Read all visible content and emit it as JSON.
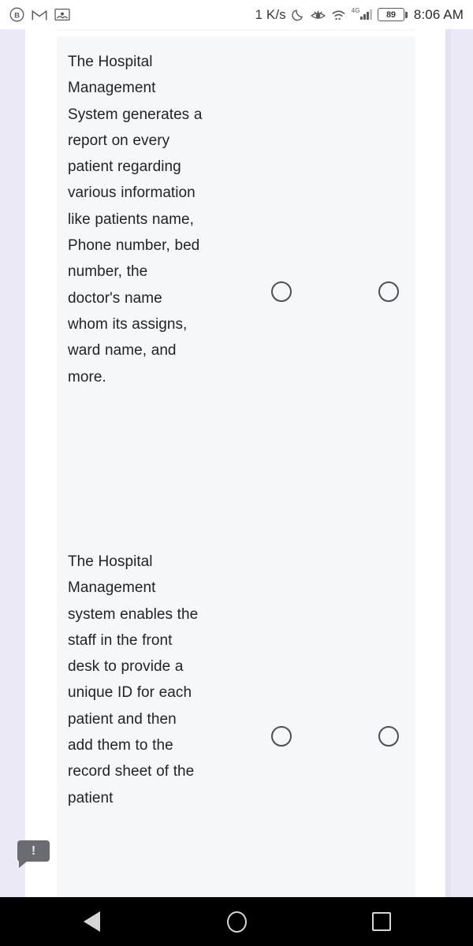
{
  "status_bar": {
    "notification_icons": [
      {
        "name": "bitwarden-icon",
        "glyph": "B"
      },
      {
        "name": "gmail-icon",
        "glyph": "M"
      },
      {
        "name": "screenshot-icon",
        "glyph": "image"
      }
    ],
    "network_rate": "1 K/s",
    "do_not_disturb_icon": "moon-icon",
    "eye_comfort_icon": "eye-icon",
    "wifi_icon": "wifi-icon",
    "mobile_network_label": "4G",
    "signal_icon": "signal-bars-icon",
    "battery_percent": "89",
    "clock": "8:06 AM"
  },
  "questions": [
    {
      "id": "q1",
      "text": "The Hospital Management System generates a report on every patient regarding various information like patients name, Phone number, bed number, the doctor's name whom its assigns, ward name, and more.",
      "options": [
        {
          "id": "q1-a",
          "selected": false
        },
        {
          "id": "q1-b",
          "selected": false
        }
      ]
    },
    {
      "id": "q2",
      "text": "The Hospital Management system enables the staff in the front desk to provide a unique ID for each patient and then add them to the record sheet of the patient",
      "options": [
        {
          "id": "q2-a",
          "selected": false
        },
        {
          "id": "q2-b",
          "selected": false
        }
      ]
    }
  ],
  "feedback_bubble": {
    "name": "feedback-icon",
    "glyph": "!"
  },
  "nav_bar": {
    "back_label": "Back",
    "home_label": "Home",
    "recents_label": "Recents"
  },
  "colors": {
    "card_background": "#f6f7f9",
    "page_background": "#ffffff",
    "gutter": "#ebe9f5",
    "text": "#232323",
    "radio_border": "#4b4f56",
    "nav_bar": "#000000"
  }
}
